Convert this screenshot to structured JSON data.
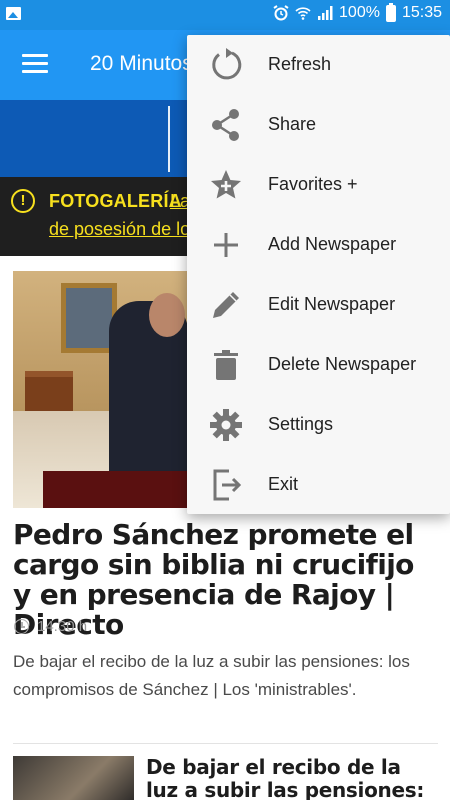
{
  "status_bar": {
    "battery": "100%",
    "time": "15:35"
  },
  "app_bar": {
    "title": "20 Minutos"
  },
  "alert": {
    "tag": "FOTOGALERÍA",
    "line1": "La toma",
    "line2": "de posesión de los"
  },
  "article": {
    "headline": "Pedro Sánchez promete el cargo sin biblia ni crucifijo y en presencia de Rajoy | Directo",
    "time": "14.30 h",
    "summary": "De bajar el recibo de la luz a subir las pensiones: los compromisos de Sánchez | Los 'ministrables'."
  },
  "article2": {
    "headline": "De bajar el recibo de la luz a subir las pensiones: los"
  },
  "menu": {
    "items": [
      {
        "label": "Refresh",
        "icon": "refresh-icon"
      },
      {
        "label": "Share",
        "icon": "share-icon"
      },
      {
        "label": "Favorites +",
        "icon": "star-plus-icon"
      },
      {
        "label": "Add Newspaper",
        "icon": "plus-icon"
      },
      {
        "label": "Edit Newspaper",
        "icon": "pencil-icon"
      },
      {
        "label": "Delete Newspaper",
        "icon": "trash-icon"
      },
      {
        "label": "Settings",
        "icon": "gear-icon"
      },
      {
        "label": "Exit",
        "icon": "exit-icon"
      }
    ]
  },
  "colors": {
    "status_bar": "#1c8fe3",
    "app_bar": "#2196f3",
    "banner": "#0d5ab5",
    "alert_bg": "#1f1f1f",
    "alert_text": "#f7e01e",
    "menu_bg": "#f7f7f7",
    "menu_icon": "#757575"
  }
}
